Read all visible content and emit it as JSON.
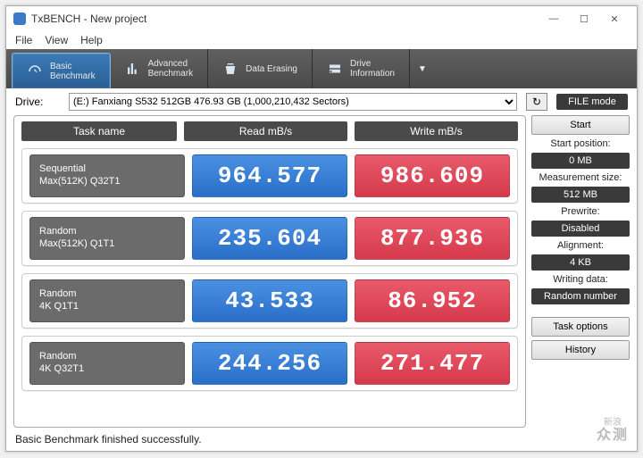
{
  "window": {
    "title": "TxBENCH - New project"
  },
  "menu": {
    "file": "File",
    "view": "View",
    "help": "Help"
  },
  "tabs": {
    "basic": {
      "l1": "Basic",
      "l2": "Benchmark"
    },
    "advanced": {
      "l1": "Advanced",
      "l2": "Benchmark"
    },
    "erase": {
      "l1": "Data Erasing"
    },
    "drive": {
      "l1": "Drive",
      "l2": "Information"
    }
  },
  "drivebar": {
    "label": "Drive:",
    "selected": "(E:) Fanxiang S532 512GB  476.93 GB (1,000,210,432 Sectors)",
    "filemode": "FILE mode"
  },
  "headers": {
    "task": "Task name",
    "read": "Read mB/s",
    "write": "Write mB/s"
  },
  "rows": [
    {
      "t1": "Sequential",
      "t2": "Max(512K) Q32T1",
      "read": "964.577",
      "write": "986.609"
    },
    {
      "t1": "Random",
      "t2": "Max(512K) Q1T1",
      "read": "235.604",
      "write": "877.936"
    },
    {
      "t1": "Random",
      "t2": "4K Q1T1",
      "read": "43.533",
      "write": "86.952"
    },
    {
      "t1": "Random",
      "t2": "4K Q32T1",
      "read": "244.256",
      "write": "271.477"
    }
  ],
  "side": {
    "start": "Start",
    "startpos_l": "Start position:",
    "startpos_v": "0 MB",
    "meas_l": "Measurement size:",
    "meas_v": "512 MB",
    "prewrite_l": "Prewrite:",
    "prewrite_v": "Disabled",
    "align_l": "Alignment:",
    "align_v": "4 KB",
    "writing_l": "Writing data:",
    "writing_v": "Random number",
    "taskopt": "Task options",
    "history": "History"
  },
  "status": "Basic Benchmark finished successfully.",
  "watermark": {
    "l1": "新浪",
    "l2": "众测"
  }
}
